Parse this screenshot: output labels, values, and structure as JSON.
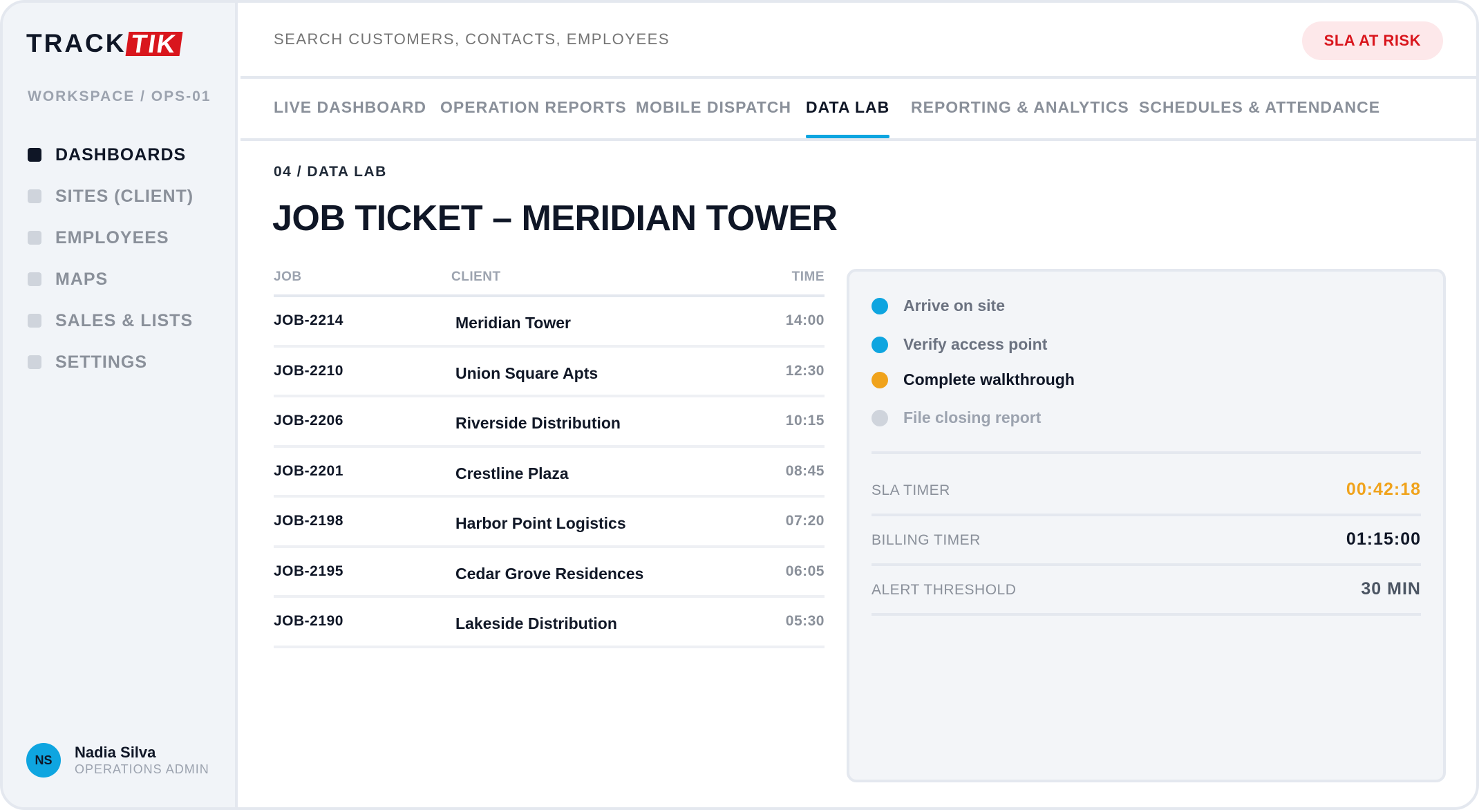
{
  "brand": {
    "part1": "TRACK",
    "part2": "TIK"
  },
  "sidebar": {
    "workspace": "WORKSPACE / OPS-01",
    "items": [
      {
        "label": "DASHBOARDS",
        "active": true
      },
      {
        "label": "SITES (CLIENT)",
        "active": false
      },
      {
        "label": "EMPLOYEES",
        "active": false
      },
      {
        "label": "MAPS",
        "active": false
      },
      {
        "label": "SALES & LISTS",
        "active": false
      },
      {
        "label": "SETTINGS",
        "active": false
      }
    ],
    "user": {
      "initials": "NS",
      "name": "Nadia Silva",
      "role": "OPERATIONS ADMIN"
    }
  },
  "topbar": {
    "search_placeholder": "SEARCH CUSTOMERS, CONTACTS, EMPLOYEES",
    "status_badge": "SLA AT RISK"
  },
  "tabs": [
    {
      "label": "LIVE DASHBOARD",
      "active": false
    },
    {
      "label": "OPERATION REPORTS",
      "active": false
    },
    {
      "label": "MOBILE DISPATCH",
      "active": false
    },
    {
      "label": "DATA LAB",
      "active": true
    },
    {
      "label": "REPORTING & ANALYTICS",
      "active": false
    },
    {
      "label": "SCHEDULES & ATTENDANCE",
      "active": false
    }
  ],
  "main": {
    "breadcrumb": "04 / DATA LAB",
    "title": "JOB TICKET – MERIDIAN TOWER",
    "table": {
      "headers": {
        "job": "JOB",
        "client": "CLIENT",
        "time": "TIME"
      },
      "rows": [
        {
          "job": "JOB-2214",
          "client": "Meridian Tower",
          "time": "14:00"
        },
        {
          "job": "JOB-2210",
          "client": "Union Square Apts",
          "time": "12:30"
        },
        {
          "job": "JOB-2206",
          "client": "Riverside Distribution",
          "time": "10:15"
        },
        {
          "job": "JOB-2201",
          "client": "Crestline Plaza",
          "time": "08:45"
        },
        {
          "job": "JOB-2198",
          "client": "Harbor Point Logistics",
          "time": "07:20"
        },
        {
          "job": "JOB-2195",
          "client": "Cedar Grove Residences",
          "time": "06:05"
        },
        {
          "job": "JOB-2190",
          "client": "Lakeside Distribution",
          "time": "05:30"
        }
      ]
    },
    "panel": {
      "steps": [
        {
          "label": "Arrive on site",
          "status": "done",
          "color": "#0ea5e0"
        },
        {
          "label": "Verify access point",
          "status": "done",
          "color": "#0ea5e0"
        },
        {
          "label": "Complete walkthrough",
          "status": "current",
          "color": "#f0a31c"
        },
        {
          "label": "File closing report",
          "status": "pending",
          "color": "#cfd4dc"
        }
      ],
      "metrics": [
        {
          "label": "SLA TIMER",
          "value": "00:42:18"
        },
        {
          "label": "BILLING TIMER",
          "value": "01:15:00"
        },
        {
          "label": "ALERT THRESHOLD",
          "value": "30 MIN"
        }
      ]
    }
  },
  "colors": {
    "brand_red": "#d9161d",
    "accent_blue": "#0ea5e0",
    "warning_orange": "#f0a31c",
    "ink": "#0f1626"
  }
}
